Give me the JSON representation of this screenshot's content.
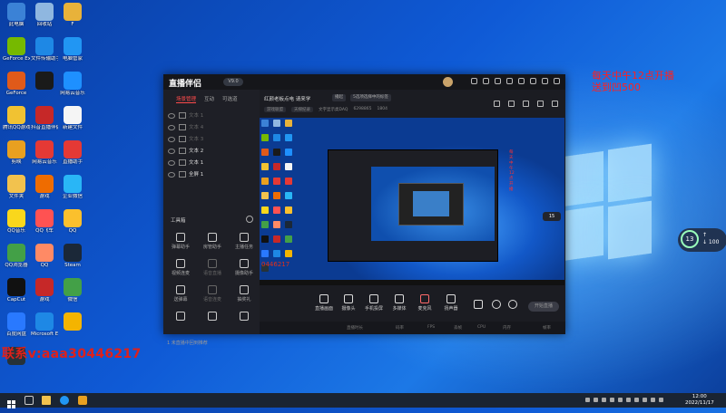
{
  "desktop": {
    "icons": [
      {
        "label": "此电脑",
        "color": "#3b82d6"
      },
      {
        "label": "回收站",
        "color": "#8fb7e0"
      },
      {
        "label": "F",
        "color": "#e8b23a"
      },
      {
        "label": "GeForce Experience",
        "color": "#76b900"
      },
      {
        "label": "文件传输助手",
        "color": "#1e88e5"
      },
      {
        "label": "电脑管家",
        "color": "#2196f3"
      },
      {
        "label": "GeForce",
        "color": "#e05a1a"
      },
      {
        "label": "",
        "color": "#1a1a1a"
      },
      {
        "label": "网易云音乐",
        "color": "#1e90ff"
      },
      {
        "label": "腾讯QQ游戏",
        "color": "#f1c232"
      },
      {
        "label": "抖音直播伴侣",
        "color": "#c62828"
      },
      {
        "label": "新建文件",
        "color": "#f5f5f5"
      },
      {
        "label": "剪映",
        "color": "#e8a020"
      },
      {
        "label": "网易云音乐",
        "color": "#e53935"
      },
      {
        "label": "直播助手",
        "color": "#e53935"
      },
      {
        "label": "文件夹",
        "color": "#f2c24e"
      },
      {
        "label": "游戏",
        "color": "#ef6c00"
      },
      {
        "label": "企业微信",
        "color": "#29b6f6"
      },
      {
        "label": "QQ音乐",
        "color": "#f9d71c"
      },
      {
        "label": "QQ飞车",
        "color": "#ff5252"
      },
      {
        "label": "QQ",
        "color": "#fbc02d"
      },
      {
        "label": "QQ浏览器",
        "color": "#43a047"
      },
      {
        "label": "QQ",
        "color": "#ff8a65"
      },
      {
        "label": "Steam",
        "color": "#1b2838"
      },
      {
        "label": "CapCut",
        "color": "#111111"
      },
      {
        "label": "游戏",
        "color": "#c62828"
      },
      {
        "label": "微信",
        "color": "#43a047"
      },
      {
        "label": "百度网盘",
        "color": "#2979ff"
      },
      {
        "label": "Microsoft Edge",
        "color": "#1e88e5"
      },
      {
        "label": "",
        "color": "#f4b400"
      },
      {
        "label": "",
        "color": "#263238"
      }
    ],
    "promo_line1": "每天中午12点开播",
    "promo_line2": "送到凹500",
    "contact_text": "联系v:aaa30446217",
    "widget_value": "13",
    "widget_line1": "↑",
    "widget_line2": "↓ 100"
  },
  "app": {
    "logo_text": "直播伴侣",
    "version_badge": "V9.0",
    "left_tabs": [
      "场景管理",
      "互动",
      "可选道"
    ],
    "scenes": [
      {
        "label": "文本 1",
        "active": false
      },
      {
        "label": "文本 4",
        "active": false
      },
      {
        "label": "文本 3",
        "active": false
      },
      {
        "label": "文本 2",
        "active": true
      },
      {
        "label": "文本 1",
        "active": true
      },
      {
        "label": "全屏 1",
        "active": true
      }
    ],
    "tools_title": "工具箱",
    "tools": [
      {
        "label": "弹幕助手",
        "dim": false
      },
      {
        "label": "房管助手",
        "dim": false
      },
      {
        "label": "主播任务",
        "dim": false
      },
      {
        "label": "视频连麦",
        "dim": false
      },
      {
        "label": "语音直播",
        "dim": true
      },
      {
        "label": "摄像助手",
        "dim": false
      },
      {
        "label": "送弹幕",
        "dim": false
      },
      {
        "label": "语音连麦",
        "dim": true
      },
      {
        "label": "抽奖礼",
        "dim": false
      },
      {
        "label": "",
        "dim": false
      },
      {
        "label": "",
        "dim": false
      },
      {
        "label": "",
        "dim": false
      }
    ],
    "bottom_note": "1 未直播中回到推荐",
    "room_title": "红颜老板点电 请来学",
    "chips": [
      "播起",
      "5选项选择中的标签"
    ],
    "meta": [
      "游戏联盟",
      "天梯纪录",
      "文字显示类DAQ",
      "6298865",
      "1804"
    ],
    "preview_overlay": "0446217",
    "preview_badge": "15",
    "nested_red_text": "每天中午12点开播",
    "bottom_tools": [
      "直播画面",
      "摄像头",
      "手机投屏",
      "多媒体",
      "麦克风",
      "扬声器"
    ],
    "start_live": "开始直播",
    "status": [
      "直播时长",
      "码率",
      "FPS",
      "丢帧",
      "CPU",
      "内存",
      "帧率"
    ]
  },
  "taskbar": {
    "time": "12:00",
    "date": "2022/11/17"
  }
}
